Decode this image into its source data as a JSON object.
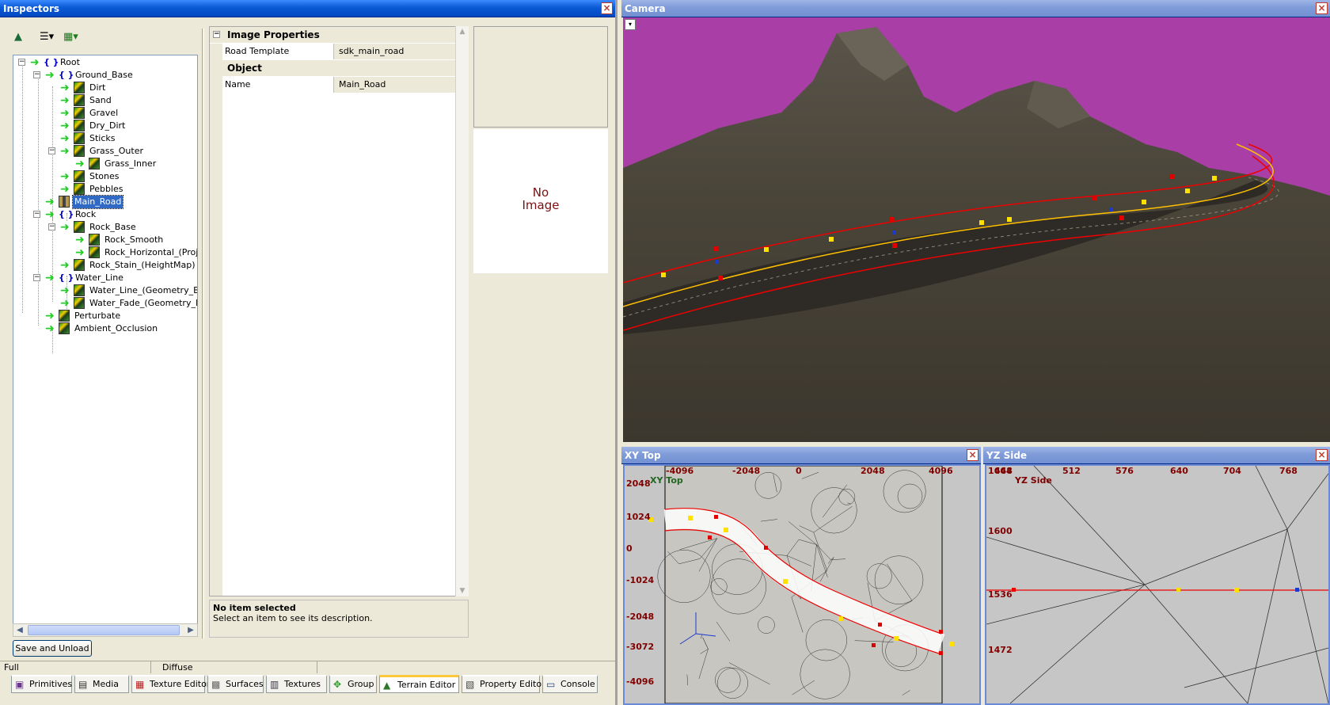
{
  "inspectors": {
    "title": "Inspectors",
    "toolbar": {
      "icons": [
        "terrain-icon",
        "layers-dropdown-icon",
        "texture-dropdown-icon"
      ]
    },
    "tree": [
      {
        "label": "Root",
        "type": "group"
      },
      {
        "label": "Ground_Base",
        "type": "group"
      },
      {
        "label": "Dirt",
        "type": "texture"
      },
      {
        "label": "Sand",
        "type": "texture"
      },
      {
        "label": "Gravel",
        "type": "texture"
      },
      {
        "label": "Dry_Dirt",
        "type": "texture"
      },
      {
        "label": "Sticks",
        "type": "texture"
      },
      {
        "label": "Grass_Outer",
        "type": "texture"
      },
      {
        "label": "Grass_Inner",
        "type": "texture"
      },
      {
        "label": "Stones",
        "type": "texture"
      },
      {
        "label": "Pebbles",
        "type": "texture"
      },
      {
        "label": "Main_Road",
        "type": "road",
        "selected": true
      },
      {
        "label": "Rock",
        "type": "group"
      },
      {
        "label": "Rock_Base",
        "type": "texture"
      },
      {
        "label": "Rock_Smooth",
        "type": "texture"
      },
      {
        "label": "Rock_Horizontal_(Projec",
        "type": "texture"
      },
      {
        "label": "Rock_Stain_(HeightMap)",
        "type": "texture"
      },
      {
        "label": "Water_Line",
        "type": "group"
      },
      {
        "label": "Water_Line_(Geometry_Bas",
        "type": "texture"
      },
      {
        "label": "Water_Fade_(Geometry_Ba",
        "type": "texture"
      },
      {
        "label": "Perturbate",
        "type": "texture"
      },
      {
        "label": "Ambient_Occlusion",
        "type": "texture"
      }
    ],
    "properties": {
      "section1": "Image Properties",
      "road_template_label": "Road Template",
      "road_template_value": "sdk_main_road",
      "section2": "Object",
      "name_label": "Name",
      "name_value": "Main_Road"
    },
    "description": {
      "title": "No item selected",
      "text": "Select an item to see its description."
    },
    "preview": {
      "text_line1": "No",
      "text_line2": "Image"
    },
    "save_unload": "Save and Unload",
    "status": {
      "left": "Full",
      "right": "Diffuse"
    },
    "tabs": [
      {
        "label": "Primitives",
        "icon": "primitives-icon"
      },
      {
        "label": "Media",
        "icon": "media-icon"
      },
      {
        "label": "Texture Editor",
        "icon": "texture-editor-icon"
      },
      {
        "label": "Surfaces",
        "icon": "surfaces-icon"
      },
      {
        "label": "Textures",
        "icon": "textures-icon"
      },
      {
        "label": "Group",
        "icon": "group-icon"
      },
      {
        "label": "Terrain Editor",
        "icon": "terrain-editor-icon",
        "active": true
      },
      {
        "label": "Property Editor",
        "icon": "property-editor-icon"
      },
      {
        "label": "Console",
        "icon": "console-icon"
      }
    ]
  },
  "camera": {
    "title": "Camera"
  },
  "xy_top": {
    "title": "XY Top",
    "label": "XY Top",
    "x_ticks": [
      "-4096",
      "-2048",
      "0",
      "2048",
      "4096"
    ],
    "y_ticks": [
      "2048",
      "1024",
      "0",
      "-1024",
      "-2048",
      "-3072",
      "-4096"
    ]
  },
  "yz_side": {
    "title": "YZ Side",
    "label": "YZ Side",
    "x_ticks": [
      "448",
      "512",
      "576",
      "640",
      "704",
      "768"
    ],
    "corner_tick": "1664",
    "y_ticks": [
      "1600",
      "1536",
      "1472"
    ]
  },
  "colors": {
    "selection": "#316ac5",
    "road_spline": "#ffd700",
    "road_edge": "#ff0000",
    "sky": "#a93fa6"
  }
}
